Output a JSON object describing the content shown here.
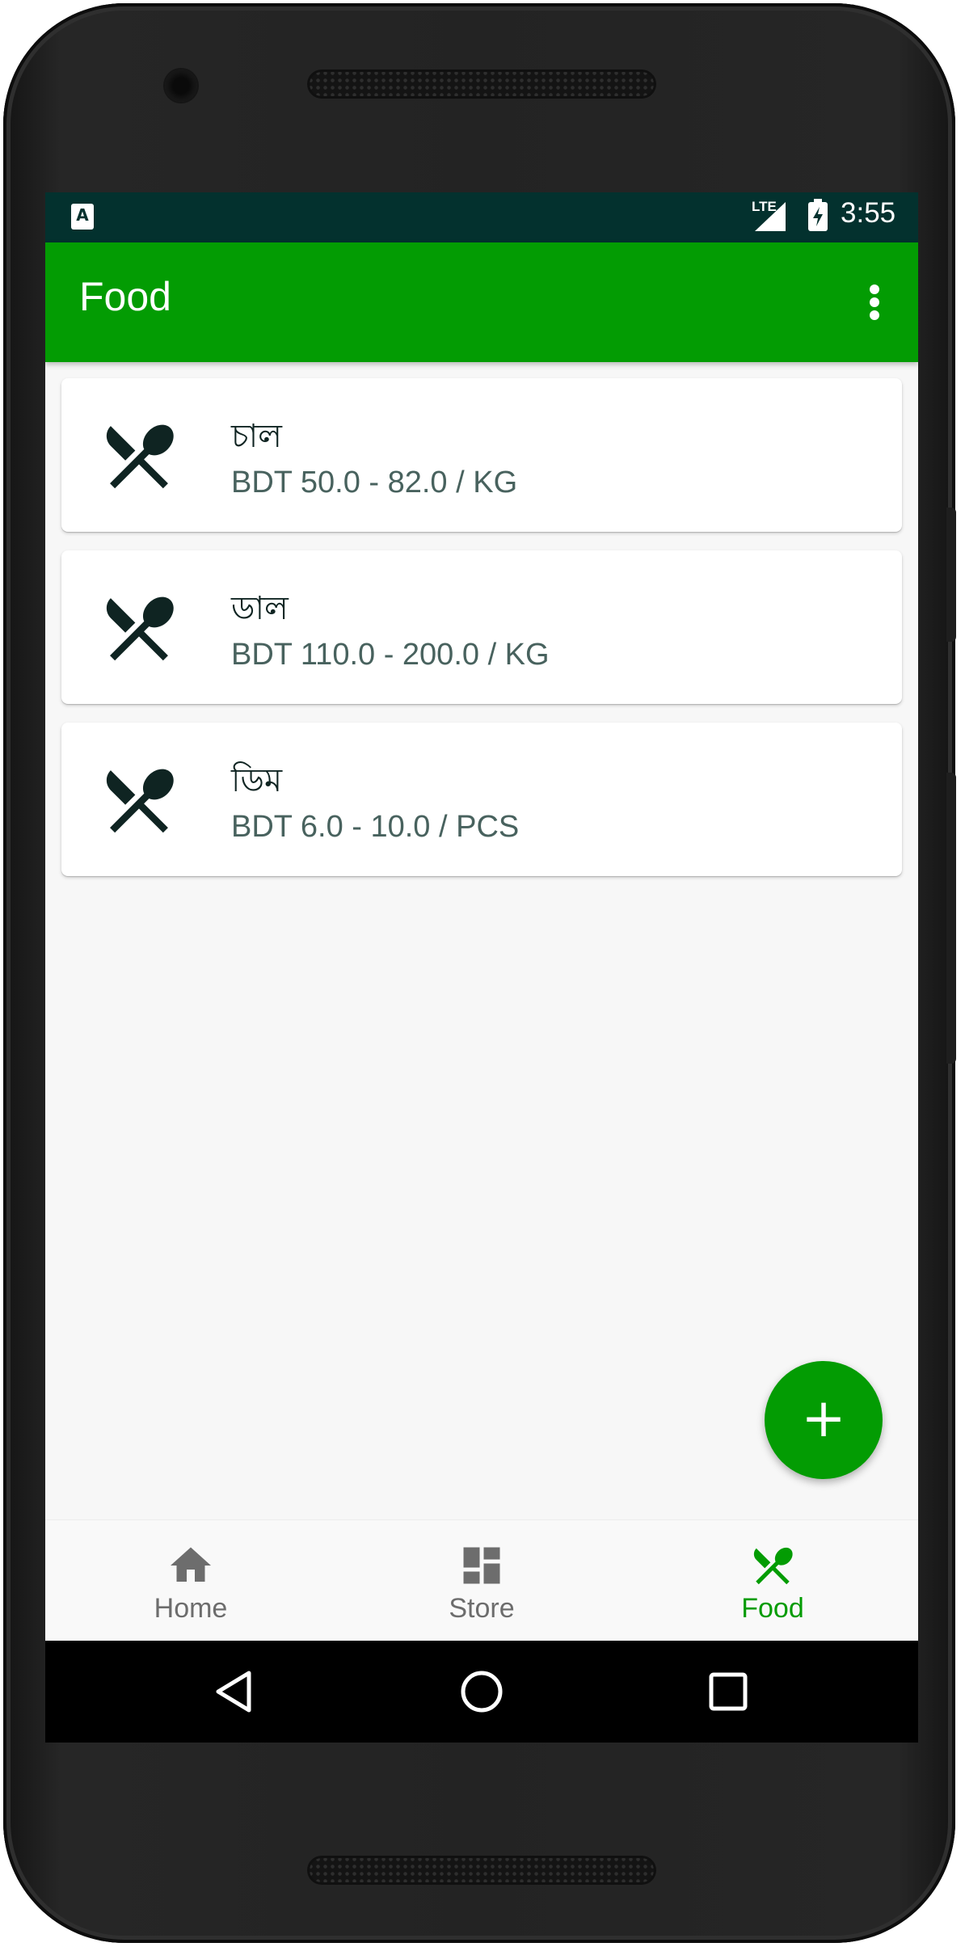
{
  "status_bar": {
    "notification_icon": "a-notification-icon",
    "network": "LTE",
    "time": "3:55"
  },
  "app_bar": {
    "title": "Food",
    "menu_icon": "more-vert-icon"
  },
  "food_items": [
    {
      "name": "চাল",
      "price": "BDT 50.0 - 82.0 / KG",
      "icon": "restaurant-icon"
    },
    {
      "name": "ডাল",
      "price": "BDT 110.0 - 200.0 / KG",
      "icon": "restaurant-icon"
    },
    {
      "name": "ডিম",
      "price": "BDT 6.0 - 10.0 / PCS",
      "icon": "restaurant-icon"
    }
  ],
  "fab": {
    "label": "+",
    "icon": "add-icon"
  },
  "bottom_nav": [
    {
      "label": "Home",
      "icon": "home-icon",
      "active": false
    },
    {
      "label": "Store",
      "icon": "dashboard-icon",
      "active": false
    },
    {
      "label": "Food",
      "icon": "restaurant-icon",
      "active": true
    }
  ],
  "colors": {
    "primary": "#039c03",
    "status_bar": "#03312e",
    "icon_dark": "#0f2422",
    "secondary_text": "#48625e",
    "inactive_nav": "#6d6d6d"
  }
}
